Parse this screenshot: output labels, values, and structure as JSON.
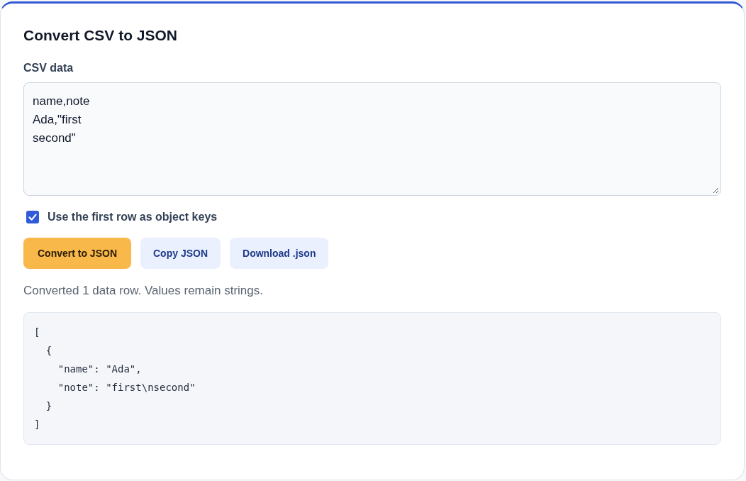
{
  "title": "Convert CSV to JSON",
  "csv_field": {
    "label": "CSV data",
    "value": "name,note\nAda,\"first\nsecond\""
  },
  "header_checkbox": {
    "label": "Use the first row as object keys",
    "checked": true
  },
  "buttons": [
    {
      "label": "Convert to JSON",
      "kind": "primary"
    },
    {
      "label": "Copy JSON",
      "kind": "secondary"
    },
    {
      "label": "Download .json",
      "kind": "secondary"
    }
  ],
  "status": "Converted 1 data row. Values remain strings.",
  "output": "[\n  {\n    \"name\": \"Ada\",\n    \"note\": \"first\\nsecond\"\n  }\n]"
}
